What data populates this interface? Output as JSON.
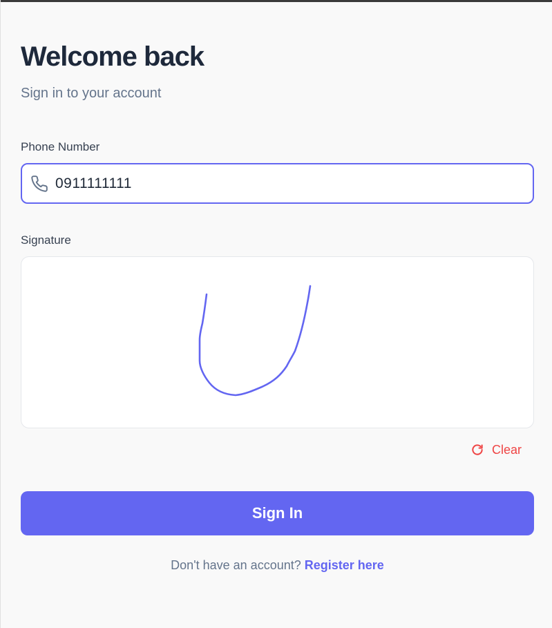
{
  "header": {
    "title": "Welcome back",
    "subtitle": "Sign in to your account"
  },
  "phone": {
    "label": "Phone Number",
    "value": "0911111111",
    "icon": "phone-icon"
  },
  "signature": {
    "label": "Signature",
    "clear_label": "Clear",
    "clear_icon": "refresh-icon"
  },
  "actions": {
    "signin_label": "Sign In"
  },
  "footer": {
    "prompt": "Don't have an account?",
    "register_link": "Register here"
  },
  "colors": {
    "accent": "#6366f1",
    "danger": "#ef4444",
    "heading": "#1e293b",
    "muted": "#64748b"
  }
}
